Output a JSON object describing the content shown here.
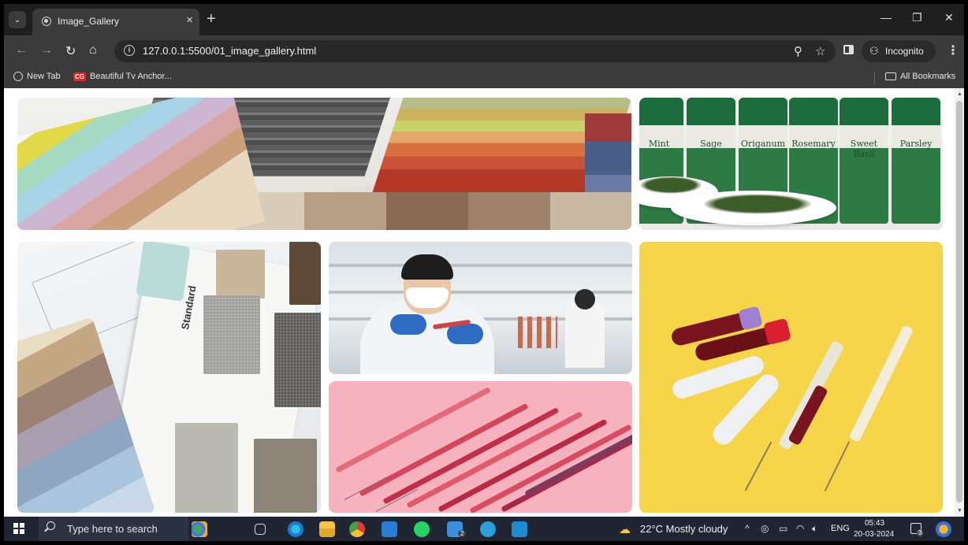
{
  "browser": {
    "tab": {
      "title": "Image_Gallery",
      "close_glyph": "×",
      "menu_glyph": "⌄"
    },
    "new_tab_glyph": "+",
    "window_controls": {
      "minimize": "—",
      "restore": "❐",
      "close": "✕"
    },
    "nav": {
      "back": "←",
      "forward": "→",
      "reload": "↻",
      "home": "⌂"
    },
    "omnibox": {
      "url": "127.0.0.1:5500/01_image_gallery.html"
    },
    "omni_icons": {
      "zoom": "⚲",
      "star": "☆"
    },
    "incognito": {
      "icon": "⚇",
      "label": "Incognito"
    },
    "menu": "⋮",
    "bookmarks": {
      "items": [
        {
          "label": "New Tab",
          "icon": "globe-icon"
        },
        {
          "label": "Beautiful Tv Anchor...",
          "badge": "CG"
        }
      ],
      "all_bookmarks": "All Bookmarks"
    }
  },
  "gallery": {
    "images": [
      {
        "name": "fabric-swatches-photo",
        "subject": "fabric and color swatches"
      },
      {
        "name": "spice-jars-photo",
        "subject": "spice jars and herb bowls"
      },
      {
        "name": "material-samples-photo",
        "subject": "architecture material samples"
      },
      {
        "name": "lab-scientist-photo",
        "subject": "scientist in laboratory"
      },
      {
        "name": "syringes-pink-photo",
        "subject": "syringes on pink background"
      },
      {
        "name": "blood-tubes-photo",
        "subject": "blood tubes and syringes on yellow"
      }
    ],
    "jar_labels": [
      "Mint",
      "Sage",
      "Origanum",
      "Rosemary",
      "Sweet Basil",
      "Parsley"
    ],
    "sample_card_label": "Standard"
  },
  "taskbar": {
    "search_placeholder": "Type here to search",
    "weather": "22°C  Mostly cloudy",
    "language": "ENG",
    "time": "05:43",
    "date": "20-03-2024",
    "mail_badge": "2",
    "notification_badge": "3",
    "tray": {
      "chevron": "^",
      "volume": "🔈︎"
    }
  },
  "colors": {
    "chrome_dark": "#1f1f1f",
    "chrome_toolbar": "#3b3b3b",
    "taskbar": "#1f2533",
    "page_bg": "#ffffff"
  }
}
